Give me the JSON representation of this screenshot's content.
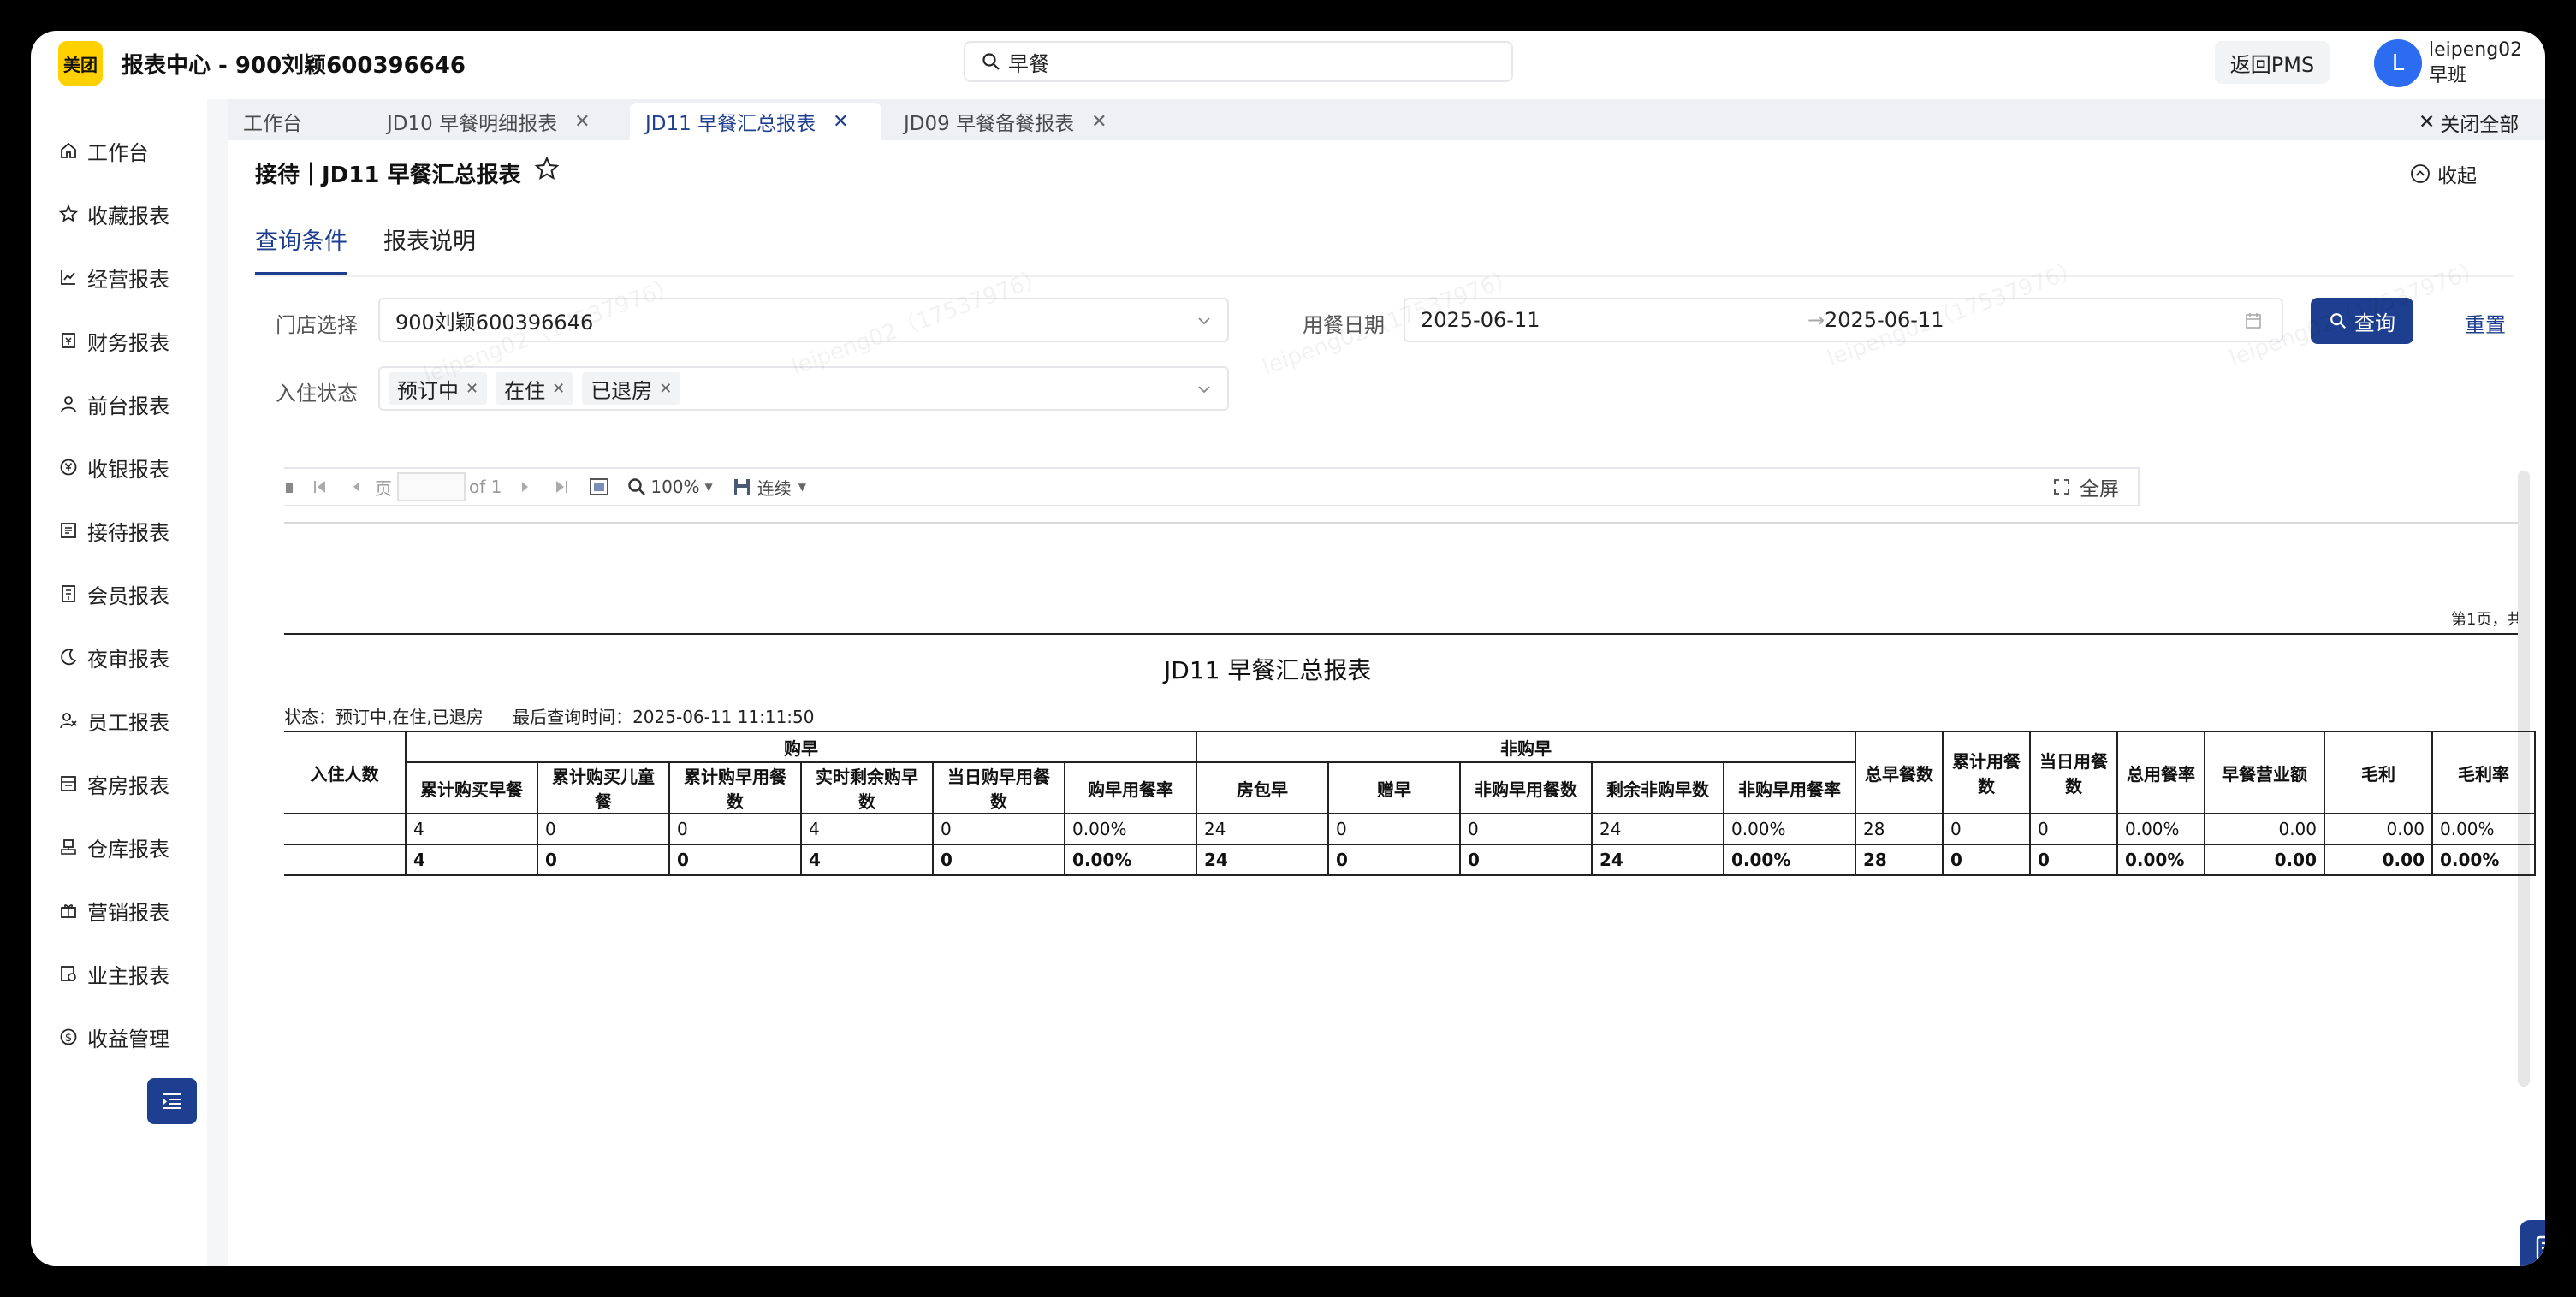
{
  "app": {
    "logo": "美团",
    "title": "报表中心 - 900刘颖600396646"
  },
  "search": {
    "value": "早餐"
  },
  "header": {
    "back_pms": "返回PMS",
    "avatar_letter": "L",
    "user_name": "leipeng02",
    "shift": "早班"
  },
  "sidebar": {
    "items": [
      {
        "label": "工作台",
        "icon": "home-icon"
      },
      {
        "label": "收藏报表",
        "icon": "star-icon"
      },
      {
        "label": "经营报表",
        "icon": "chart-line-icon"
      },
      {
        "label": "财务报表",
        "icon": "finance-icon"
      },
      {
        "label": "前台报表",
        "icon": "user-icon"
      },
      {
        "label": "收银报表",
        "icon": "yen-icon"
      },
      {
        "label": "接待报表",
        "icon": "list-icon"
      },
      {
        "label": "会员报表",
        "icon": "member-icon"
      },
      {
        "label": "夜审报表",
        "icon": "moon-icon"
      },
      {
        "label": "员工报表",
        "icon": "staff-icon"
      },
      {
        "label": "客房报表",
        "icon": "room-icon"
      },
      {
        "label": "仓库报表",
        "icon": "warehouse-icon"
      },
      {
        "label": "营销报表",
        "icon": "gift-icon"
      },
      {
        "label": "业主报表",
        "icon": "owner-icon"
      },
      {
        "label": "收益管理",
        "icon": "dollar-icon"
      }
    ]
  },
  "tabs": [
    {
      "label": "工作台",
      "closable": false
    },
    {
      "label": "JD10 早餐明细报表",
      "closable": true
    },
    {
      "label": "JD11 早餐汇总报表",
      "closable": true,
      "active": true
    },
    {
      "label": "JD09 早餐备餐报表",
      "closable": true
    }
  ],
  "close_all": "关闭全部",
  "page": {
    "breadcrumb": "接待｜JD11 早餐汇总报表",
    "collapse": "收起"
  },
  "query_tabs": [
    "查询条件",
    "报表说明"
  ],
  "form": {
    "store_label": "门店选择",
    "store_value": "900刘颖600396646",
    "date_label": "用餐日期",
    "date_start": "2025-06-11",
    "date_arrow": "→",
    "date_end": "2025-06-11",
    "status_label": "入住状态",
    "status_tags": [
      "预订中",
      "在住",
      "已退房"
    ],
    "query_button": "查询",
    "reset_button": "重置"
  },
  "viewer": {
    "page_label": "页",
    "page_of": "of 1",
    "zoom": "100%",
    "mode": "连续",
    "fullscreen": "全屏"
  },
  "report": {
    "page_info": "第1页，共",
    "title": "JD11 早餐汇总报表",
    "status": "状态：预订中,在住,已退房",
    "query_time": "最后查询时间：2025-06-11 11:11:50",
    "headers": {
      "guests": "入住人数",
      "buy_group": "购早",
      "nonbuy_group": "非购早",
      "buy_cols": [
        "累计购买早餐",
        "累计购买儿童餐",
        "累计购早用餐数",
        "实时剩余购早数",
        "当日购早用餐数",
        "购早用餐率"
      ],
      "nonbuy_cols": [
        "房包早",
        "赠早",
        "非购早用餐数",
        "剩余非购早数",
        "非购早用餐率"
      ],
      "tail_cols": [
        "总早餐数",
        "累计用餐数",
        "当日用餐数",
        "总用餐率",
        "早餐营业额",
        "毛利",
        "毛利率"
      ]
    },
    "rows": [
      [
        "",
        "4",
        "0",
        "0",
        "4",
        "0",
        "0.00%",
        "24",
        "0",
        "0",
        "24",
        "0.00%",
        "28",
        "0",
        "0",
        "0.00%",
        "0.00",
        "0.00",
        "0.00%"
      ],
      [
        "",
        "4",
        "0",
        "0",
        "4",
        "0",
        "0.00%",
        "24",
        "0",
        "0",
        "24",
        "0.00%",
        "28",
        "0",
        "0",
        "0.00%",
        "0.00",
        "0.00",
        "0.00%"
      ]
    ]
  },
  "watermark": "leipeng02（17537976）",
  "colors": {
    "primary": "#1e3f8f",
    "brand_yellow": "#ffd100",
    "avatar_blue": "#2b6cf0"
  }
}
